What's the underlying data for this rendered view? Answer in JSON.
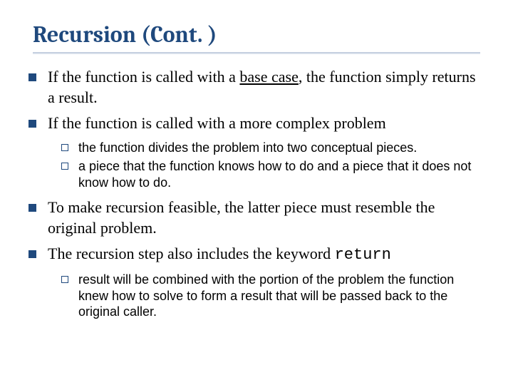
{
  "title": "Recursion (Cont. )",
  "bullets": [
    {
      "pre": "If the function is called with a ",
      "underlined": "base case",
      "post": ", the function simply returns a result."
    },
    {
      "text": "If the function is called with a more complex problem"
    }
  ],
  "sub_bullets_1": [
    "the function divides the problem into two conceptual pieces.",
    "a piece that the function knows how to do and a piece that it does not know how to do."
  ],
  "bullets_2": [
    "To make recursion feasible, the latter piece must resemble the original problem."
  ],
  "bullet_return": {
    "pre": "The recursion step also includes the keyword ",
    "kw": "return"
  },
  "sub_bullets_2": [
    "result will be combined with the portion of the problem the function knew how to solve to form a result that will be passed back to the original caller."
  ]
}
